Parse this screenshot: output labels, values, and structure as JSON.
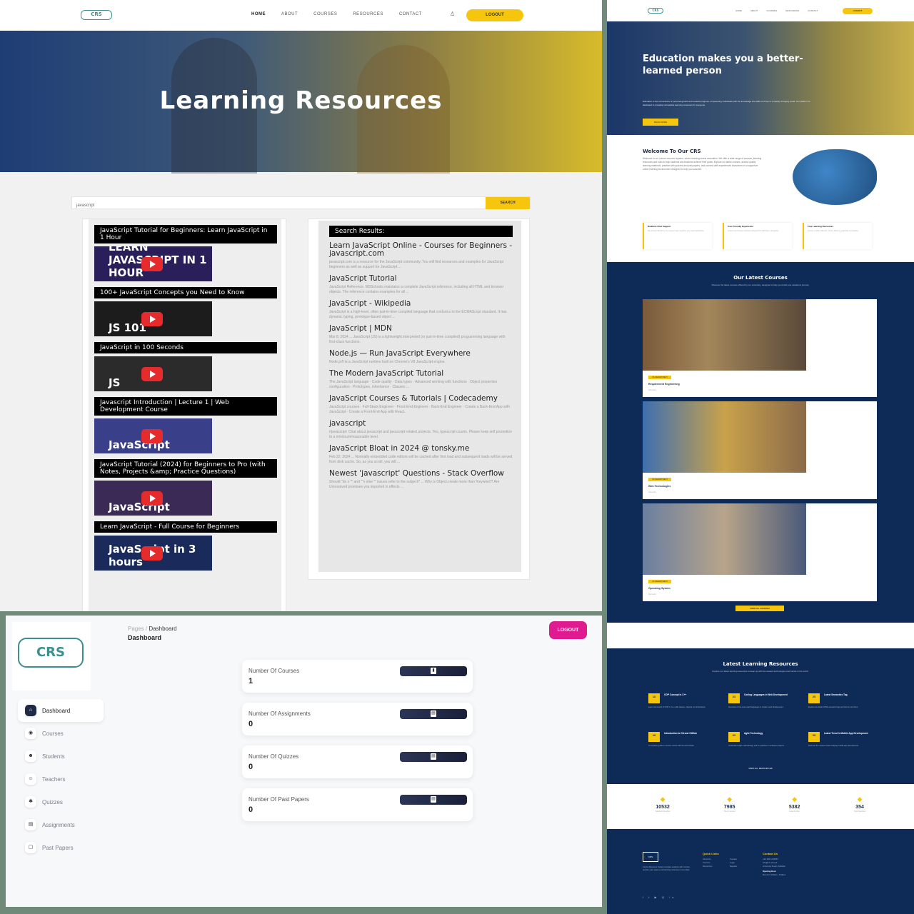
{
  "learning_page": {
    "logo": "CRS",
    "nav": [
      "HOME",
      "ABOUT",
      "COURSES",
      "RESOURCES",
      "CONTACT"
    ],
    "logout": "LOGOUT",
    "hero_title": "Learning Resources",
    "search_value": "javascript",
    "search_button": "SEARCH",
    "videos": [
      {
        "title": "JavaScript Tutorial for Beginners: Learn JavaScript in 1 Hour",
        "thumb": "LEARN JAVASCRIPT IN 1 HOUR",
        "bg": "#2a1f5a"
      },
      {
        "title": "100+ JavaScript Concepts you Need to Know",
        "thumb": "JS 101",
        "bg": "#1c1c1c"
      },
      {
        "title": "JavaScript in 100 Seconds",
        "thumb": "JS",
        "bg": "#2b2b2b"
      },
      {
        "title": "Javascript Introduction | Lecture 1 | Web Development Course",
        "thumb": "JavaScript",
        "bg": "#3a3f8a"
      },
      {
        "title": "JavaScript Tutorial (2024) for Beginners to Pro (with Notes, Projects &amp; Practice Questions)",
        "thumb": "JavaScript",
        "bg": "#3b2a55"
      },
      {
        "title": "Learn JavaScript - Full Course for Beginners",
        "thumb": "JavaScript in 3 hours",
        "bg": "#1a2a5a"
      }
    ],
    "results_header": "Search Results:",
    "results": [
      {
        "title": "Learn JavaScript Online - Courses for Beginners - javascript.com",
        "snippet": "javascript.com is a resource for the JavaScript community. You will find resources and examples for JavaScript beginners as well as support for JavaScript ..."
      },
      {
        "title": "JavaScript Tutorial",
        "snippet": "JavaScript Reference. W3Schools maintains a complete JavaScript reference, including all HTML and browser objects. The reference contains examples for all ..."
      },
      {
        "title": "JavaScript - Wikipedia",
        "snippet": "JavaScript is a high-level, often just-in-time compiled language that conforms to the ECMAScript standard. It has dynamic typing, prototype-based object ..."
      },
      {
        "title": "JavaScript | MDN",
        "snippet": "Mar 8, 2024 ... JavaScript (JS) is a lightweight interpreted (or just-in-time compiled) programming language with first-class functions."
      },
      {
        "title": "Node.js — Run JavaScript Everywhere",
        "snippet": "Node.js® is a JavaScript runtime built on Chrome's V8 JavaScript engine."
      },
      {
        "title": "The Modern JavaScript Tutorial",
        "snippet": "The JavaScript language · Code quality · Data types · Advanced working with functions · Object properties configuration · Prototypes, inheritance · Classes ..."
      },
      {
        "title": "JavaScript Courses & Tutorials | Codecademy",
        "snippet": "JavaScript courses · Full-Stack Engineer · Front-End Engineer · Back-End Engineer · Create a Back-End App with JavaScript · Create a Front-End App with React."
      },
      {
        "title": "javascript",
        "snippet": "r/javascript: Chat about javascript and javascript related projects. Yes, typescript counts. Please keep self promotion to a minimum/reasonable level."
      },
      {
        "title": "JavaScript Bloat in 2024 @ tonsky.me",
        "snippet": "Feb 22, 2024 ... Normally embedded code editors will be cached after first load and subsequent loads will be served from disk cache. So, as you scroll, you will ..."
      },
      {
        "title": "Newest 'javascript' Questions - Stack Overflow",
        "snippet": "Should \"do x \"\" and \"\"x else \"\" issues refer to the subject? ... Why is Object.create more than 'Keyword'? Are Unresolved promises you imported in effects ..."
      }
    ]
  },
  "landing_page": {
    "logo": "CRS",
    "nav": [
      "HOME",
      "ABOUT",
      "COURSES",
      "RESOURCES",
      "CONTACT"
    ],
    "logout": "LOGOUT",
    "hero_title": "Education makes you a better-learned person",
    "hero_text": "Education is the cornerstone of personal growth and societal progress, empowering individuals with the knowledge and skills to thrive in a rapidly changing world. Our platform is dedicated to providing accessible learning resources for everyone.",
    "hero_button": "READ MORE",
    "welcome_title": "Welcome To Our CRS",
    "welcome_text": "Welcome to our course resource system, where learning meets innovation. We offer a wide range of courses, learning resources and tools to help students and teachers achieve their goals. Explore our latest courses, access quality learning materials, practice with quizzes and past papers, and connect with experienced instructors in a supportive online learning environment designed to help you succeed.",
    "features": [
      {
        "title": "Realtime Chat Support",
        "desc": "Get instant help from our support team anytime you need assistance."
      },
      {
        "title": "User Friendly Experience",
        "desc": "A clean and simple interface designed for effortless navigation."
      },
      {
        "title": "Free Learning Resources",
        "desc": "Access a wide collection of free learning materials and guides."
      }
    ],
    "courses_title": "Our Latest Courses",
    "courses_sub": "Discover the latest courses offered by our university, designed to help you build your academic journey.",
    "courses": [
      {
        "tag": "CS DEPARTMENT",
        "name": "Requirement Engineering",
        "meta": "Instructor"
      },
      {
        "tag": "CS DEPARTMENT",
        "name": "Web Technologies",
        "meta": "Instructor"
      },
      {
        "tag": "CS DEPARTMENT",
        "name": "Operating System",
        "meta": "Instructor"
      }
    ],
    "courses_button": "VIEW ALL COURSES",
    "resources_title": "Latest Learning Resources",
    "resources_sub": "Explore our latest learning resources to keep up with the newest technologies and trends in the world.",
    "resources": [
      {
        "day": "18",
        "title": "OOP Concept in C++",
        "desc": "Learn the basics of OOP in C++ with classes, objects and inheritance."
      },
      {
        "day": "23",
        "title": "Coding Languages in Web Development",
        "desc": "Overview of the most used languages in modern web development."
      },
      {
        "day": "25",
        "title": "Latest Semantics Tag",
        "desc": "Explore the latest HTML semantic tags and how to use them."
      },
      {
        "day": "28",
        "title": "Introduction to Git and GitHub",
        "desc": "A complete guide to version control with Git and GitHub."
      },
      {
        "day": "02",
        "title": "Agile Technology",
        "desc": "Understand agile methodology and its practices in software projects."
      },
      {
        "day": "05",
        "title": "Latest Trend in Mobile App Development",
        "desc": "Discover the newest trends shaping mobile app development."
      }
    ],
    "resources_button": "VIEW ALL RESOURCES",
    "stats": [
      {
        "icon": "graduation-icon",
        "value": "10532",
        "label": "Satisfied Students"
      },
      {
        "icon": "book-icon",
        "value": "7985",
        "label": "Total Courses"
      },
      {
        "icon": "trophy-icon",
        "value": "5382",
        "label": "Awards Won"
      },
      {
        "icon": "teacher-icon",
        "value": "354",
        "label": "Total Teachers"
      }
    ],
    "footer": {
      "logo": "CRS",
      "about": "Course Resource System provides students with courses, quizzes, past papers and learning resources in one place.",
      "links_title": "Quick Links",
      "links": [
        "About Us",
        "Courses",
        "Resources",
        "Contact",
        "Login",
        "Register"
      ],
      "contact_title": "Contact Us",
      "contact": [
        "+92 300 1234567",
        "info@crs.edu.pk",
        "University Road, Pakistan"
      ],
      "hours_title": "Opening Hour",
      "hours": "Mon-Fri: 9:00am - 5:00pm"
    }
  },
  "dashboard": {
    "logo": "CRS",
    "breadcrumb": {
      "parent": "Pages",
      "separator": "/",
      "current": "Dashboard"
    },
    "title": "Dashboard",
    "logout": "LOGOUT",
    "menu": [
      {
        "label": "Dashboard",
        "icon": "home-icon",
        "glyph": "⌂",
        "active": true
      },
      {
        "label": "Courses",
        "icon": "course-icon",
        "glyph": "◉"
      },
      {
        "label": "Students",
        "icon": "students-icon",
        "glyph": "☻"
      },
      {
        "label": "Teachers",
        "icon": "teachers-icon",
        "glyph": "☺"
      },
      {
        "label": "Quizzes",
        "icon": "quiz-icon",
        "glyph": "✱"
      },
      {
        "label": "Assignments",
        "icon": "assignment-icon",
        "glyph": "▤"
      },
      {
        "label": "Past Papers",
        "icon": "paper-icon",
        "glyph": "▢"
      }
    ],
    "stats": [
      {
        "label": "Number Of Courses",
        "value": "1"
      },
      {
        "label": "Number Of Assignments",
        "value": "0"
      },
      {
        "label": "Number Of Quizzes",
        "value": "0"
      },
      {
        "label": "Number Of Past Papers",
        "value": "0"
      }
    ],
    "accent": "#e01a8f"
  }
}
